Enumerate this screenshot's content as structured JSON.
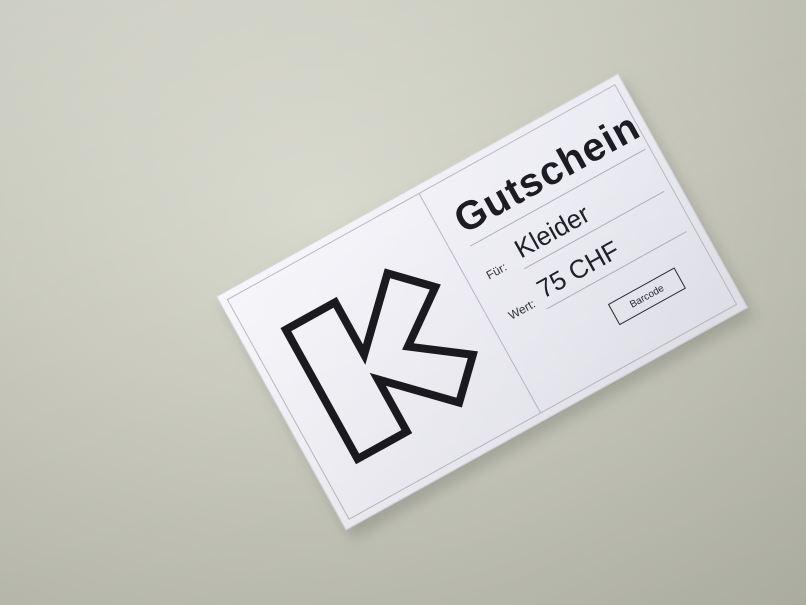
{
  "voucher": {
    "title": "Gutschein",
    "for_label": "Für:",
    "for_value": "Kleider",
    "value_label": "Wert:",
    "value_amount": "75 CHF",
    "barcode_label": "Barcode"
  },
  "logo": {
    "icon": "k-logo-icon",
    "stroke_color": "#1a1a1f"
  },
  "colors": {
    "card": "#f1f1f6",
    "surface": "#c9cabd",
    "text": "#1c1c22"
  }
}
